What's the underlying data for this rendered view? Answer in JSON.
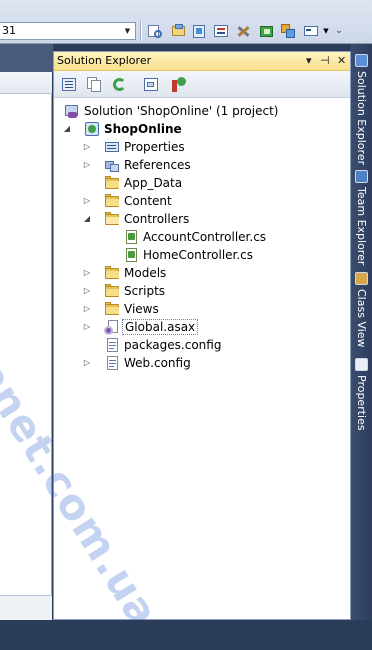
{
  "toolbar": {
    "combo_value": "31",
    "buttons": [
      "find-in-files-icon",
      "find-icon",
      "solution-explorer-icon",
      "properties-window-icon",
      "toolbox-icon",
      "extension-manager-icon",
      "start-page-icon",
      "command-window-icon",
      "dropdown-icon"
    ]
  },
  "solution_explorer": {
    "title": "Solution Explorer",
    "pin_glyph": "▾",
    "autohide_glyph": "⊣",
    "close_glyph": "✕",
    "tree": [
      {
        "label": "Solution 'ShopOnline' (1 project)",
        "icon": "solution-icon",
        "expander": ""
      },
      {
        "label": "ShopOnline",
        "icon": "project-icon",
        "expander": "◢",
        "bold": true
      },
      {
        "label": "Properties",
        "icon": "properties-icon",
        "expander": "▷"
      },
      {
        "label": "References",
        "icon": "references-icon",
        "expander": "▷"
      },
      {
        "label": "App_Data",
        "icon": "folder-icon",
        "expander": ""
      },
      {
        "label": "Content",
        "icon": "folder-icon",
        "expander": "▷"
      },
      {
        "label": "Controllers",
        "icon": "folder-open-icon",
        "expander": "◢"
      },
      {
        "label": "AccountController.cs",
        "icon": "csharp-file-icon",
        "expander": ""
      },
      {
        "label": "HomeController.cs",
        "icon": "csharp-file-icon",
        "expander": ""
      },
      {
        "label": "Models",
        "icon": "folder-icon",
        "expander": "▷"
      },
      {
        "label": "Scripts",
        "icon": "folder-icon",
        "expander": "▷"
      },
      {
        "label": "Views",
        "icon": "folder-icon",
        "expander": "▷"
      },
      {
        "label": "Global.asax",
        "icon": "asax-file-icon",
        "expander": "▷",
        "selected": true
      },
      {
        "label": "packages.config",
        "icon": "config-file-icon",
        "expander": ""
      },
      {
        "label": "Web.config",
        "icon": "config-file-icon",
        "expander": "▷"
      }
    ]
  },
  "side_tabs": [
    {
      "label": "Solution Explorer",
      "icon": "solution-explorer-tab-icon"
    },
    {
      "label": "Team Explorer",
      "icon": "team-explorer-tab-icon"
    },
    {
      "label": "Class View",
      "icon": "class-view-tab-icon"
    },
    {
      "label": "Properties",
      "icon": "properties-tab-icon"
    }
  ],
  "watermark": "www.aspnet.com.ua",
  "colors": {
    "title_bar": "#f8e08c",
    "ide_background": "#2b3c59",
    "selection_border": "#6b83b5"
  }
}
